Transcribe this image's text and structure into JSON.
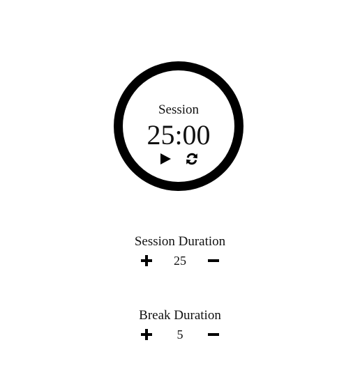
{
  "timer": {
    "label": "Session",
    "display": "25:00",
    "controls": {
      "play_icon": "play-icon",
      "reset_icon": "refresh-icon"
    },
    "ring_color": "#000000"
  },
  "session_duration": {
    "title": "Session Duration",
    "value": "25",
    "increment_icon": "plus-icon",
    "decrement_icon": "minus-icon"
  },
  "break_duration": {
    "title": "Break Duration",
    "value": "5",
    "increment_icon": "plus-icon",
    "decrement_icon": "minus-icon"
  }
}
